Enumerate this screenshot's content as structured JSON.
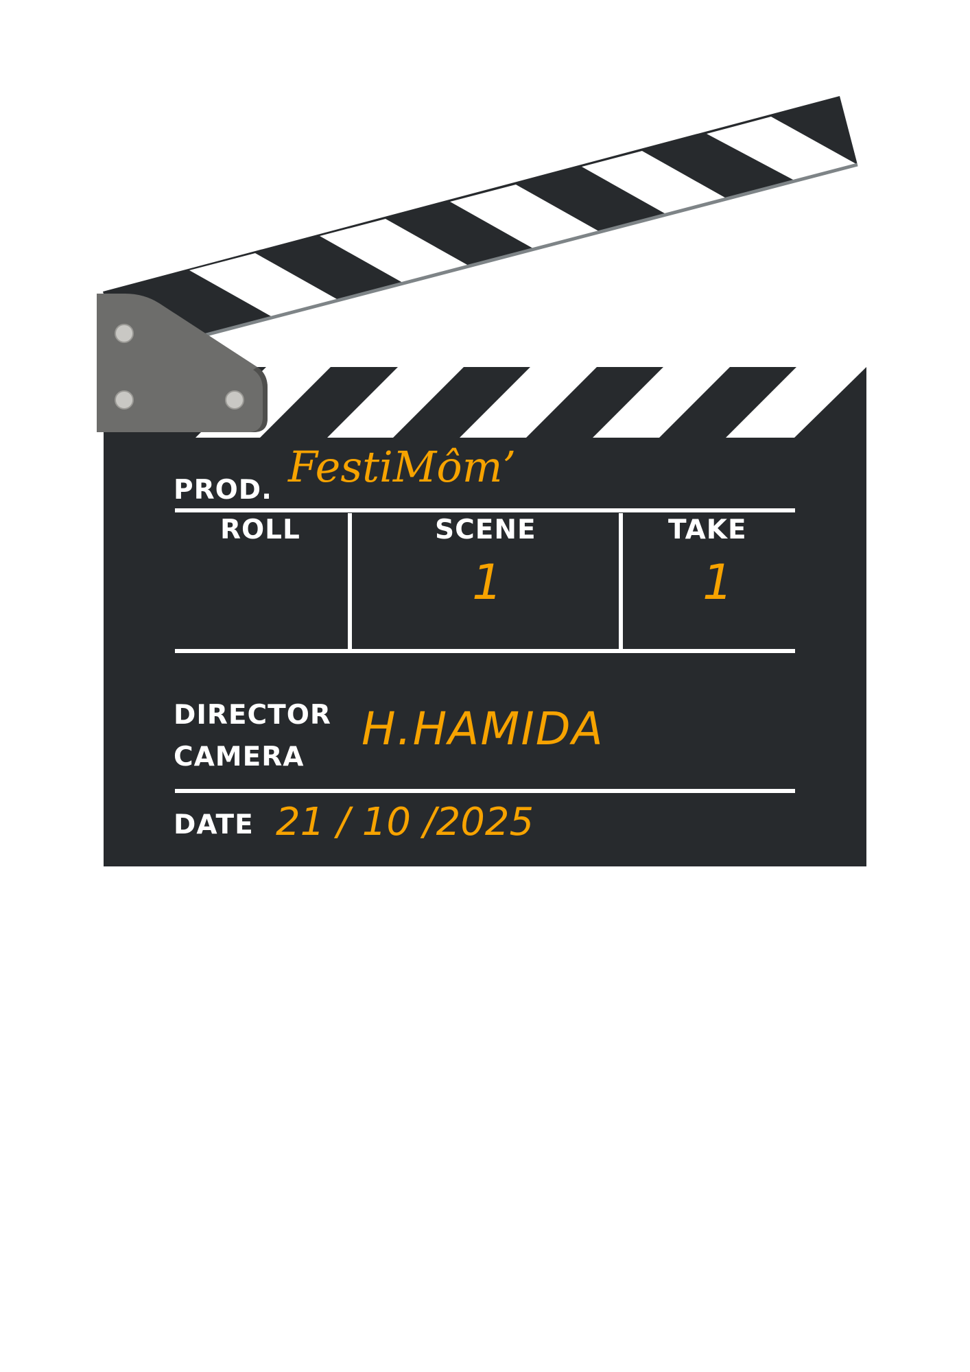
{
  "slate": {
    "prod_label": "PROD.",
    "prod_value": "FestiMôm’",
    "roll_label": "ROLL",
    "scene_label": "SCENE",
    "take_label": "TAKE",
    "scene_value": "1",
    "take_value": "1",
    "director_label": "DIRECTOR",
    "camera_label": "CAMERA",
    "director_value": "H.HAMIDA",
    "date_label": "DATE",
    "date_value": "21 / 10 /2025"
  },
  "colors": {
    "board": "#272a2d",
    "ink": "#f7a300",
    "hinge": "#6d6d6b",
    "stripe_light": "#ffffff",
    "line": "#ffffff"
  },
  "icons": {
    "hinge": "hinge-icon",
    "screw": "screw-icon"
  }
}
